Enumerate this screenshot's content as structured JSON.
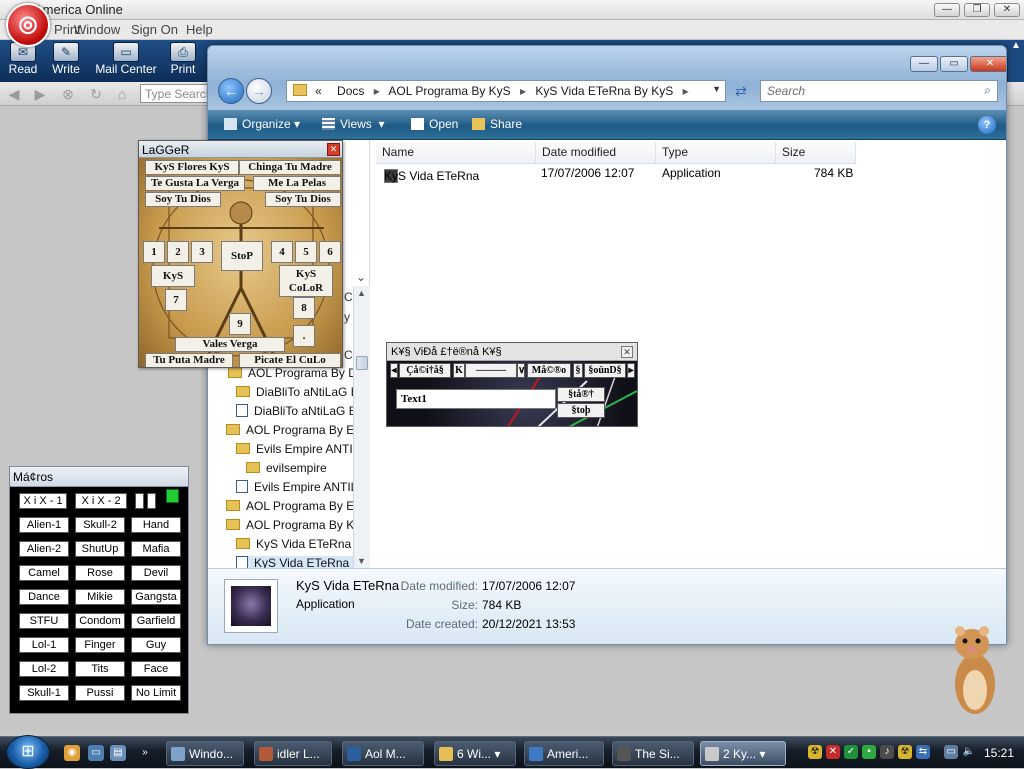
{
  "aol": {
    "title": "America Online",
    "menus": [
      "Print",
      "Window",
      "Sign On",
      "Help"
    ],
    "toolbar": [
      "Read",
      "Write",
      "Mail Center",
      "Print"
    ],
    "search_placeholder": "Type Search"
  },
  "explorer": {
    "breadcrumb": [
      "Docs",
      "AOL Programa By KyS",
      "KyS Vida ETeRna  By KyS"
    ],
    "breadcrumb_prefix": "«",
    "search_placeholder": "Search",
    "commands": [
      "Organize",
      "Views",
      "Open",
      "Share"
    ],
    "columns": [
      "Name",
      "Date modified",
      "Type",
      "Size"
    ],
    "files": [
      {
        "name": "KyS Vida ETeRna",
        "date": "17/07/2006 12:07",
        "type": "Application",
        "size": "784 KB"
      }
    ],
    "tree": [
      {
        "label": "AOL Programa By Di",
        "kind": "folder"
      },
      {
        "label": "DiaBliTo aNtiLaG B",
        "kind": "folder"
      },
      {
        "label": "DiaBliTo aNtiLaG B",
        "kind": "file"
      },
      {
        "label": "AOL Programa By Ev",
        "kind": "folder"
      },
      {
        "label": "Evils Empire ANTIL",
        "kind": "folder"
      },
      {
        "label": "evilsempire",
        "kind": "folder"
      },
      {
        "label": "Evils Empire ANTIL",
        "kind": "file"
      },
      {
        "label": "AOL Programa By Ex",
        "kind": "folder"
      },
      {
        "label": "AOL Programa By Ky",
        "kind": "folder"
      },
      {
        "label": "KyS Vida ETeRna  E",
        "kind": "folder"
      },
      {
        "label": "KyS Vida ETeRna  E",
        "kind": "file"
      }
    ],
    "cut_texts": [
      "Cl",
      "y C",
      "Cl"
    ],
    "details": {
      "name": "KyS Vida ETeRna",
      "type": "Application",
      "date_modified_label": "Date modified:",
      "date_modified": "17/07/2006 12:07",
      "size_label": "Size:",
      "size": "784 KB",
      "date_created_label": "Date created:",
      "date_created": "20/12/2021 13:53"
    }
  },
  "lagger": {
    "title": "LaGGeR",
    "row_buttons": [
      "KyS Flores KyS",
      "Chinga Tu Madre",
      "Te Gusta La Verga",
      "Me La Pelas",
      "Soy Tu Dios",
      "Soy Tu Dios"
    ],
    "num_buttons": [
      "1",
      "2",
      "3",
      "4",
      "5",
      "6"
    ],
    "stop": "StoP",
    "kys": "KyS",
    "kys_color": [
      "KyS",
      "CoLoR"
    ],
    "seven": "7",
    "eight": "8",
    "nine": "9",
    "dot": ".",
    "vales": "Vales Verga",
    "bottom": [
      "Tu Puta Madre",
      "Picate El CuLo"
    ]
  },
  "kys_window": {
    "title": "K¥§  ViÐå  £†ë®nå  K¥§",
    "buttons": [
      "Çå©i†å§",
      "K",
      "―――",
      "∨",
      "Må©®o",
      "§",
      "§oünD§"
    ],
    "textbox": "Text1",
    "start": "§tå®†",
    "stop": "§toþ"
  },
  "macros": {
    "title": "Má¢ros",
    "top": [
      "X i X - 1",
      "X i X - 2"
    ],
    "grid": [
      [
        "Alien-1",
        "Skull-2",
        "Hand"
      ],
      [
        "Alien-2",
        "ShutUp",
        "Mafia"
      ],
      [
        "Camel",
        "Rose",
        "Devil"
      ],
      [
        "Dance",
        "Mikie",
        "Gangsta"
      ],
      [
        "STFU",
        "Condom",
        "Garfield"
      ],
      [
        "Lol-1",
        "Finger",
        "Guy"
      ],
      [
        "Lol-2",
        "Tits",
        "Face"
      ],
      [
        "Skull-1",
        "Pussi",
        "No Limit"
      ]
    ]
  },
  "taskbar": {
    "items": [
      "Windo...",
      "idler L...",
      "Aol M...",
      "6 Wi...",
      "Ameri...",
      "The Si...",
      "2 Ky..."
    ],
    "clock": "15:21"
  },
  "colors": {
    "aol_toolbar": "#1f4f86",
    "explorer_cmdbar": "#1e5a85",
    "taskbar": "#151d28"
  }
}
